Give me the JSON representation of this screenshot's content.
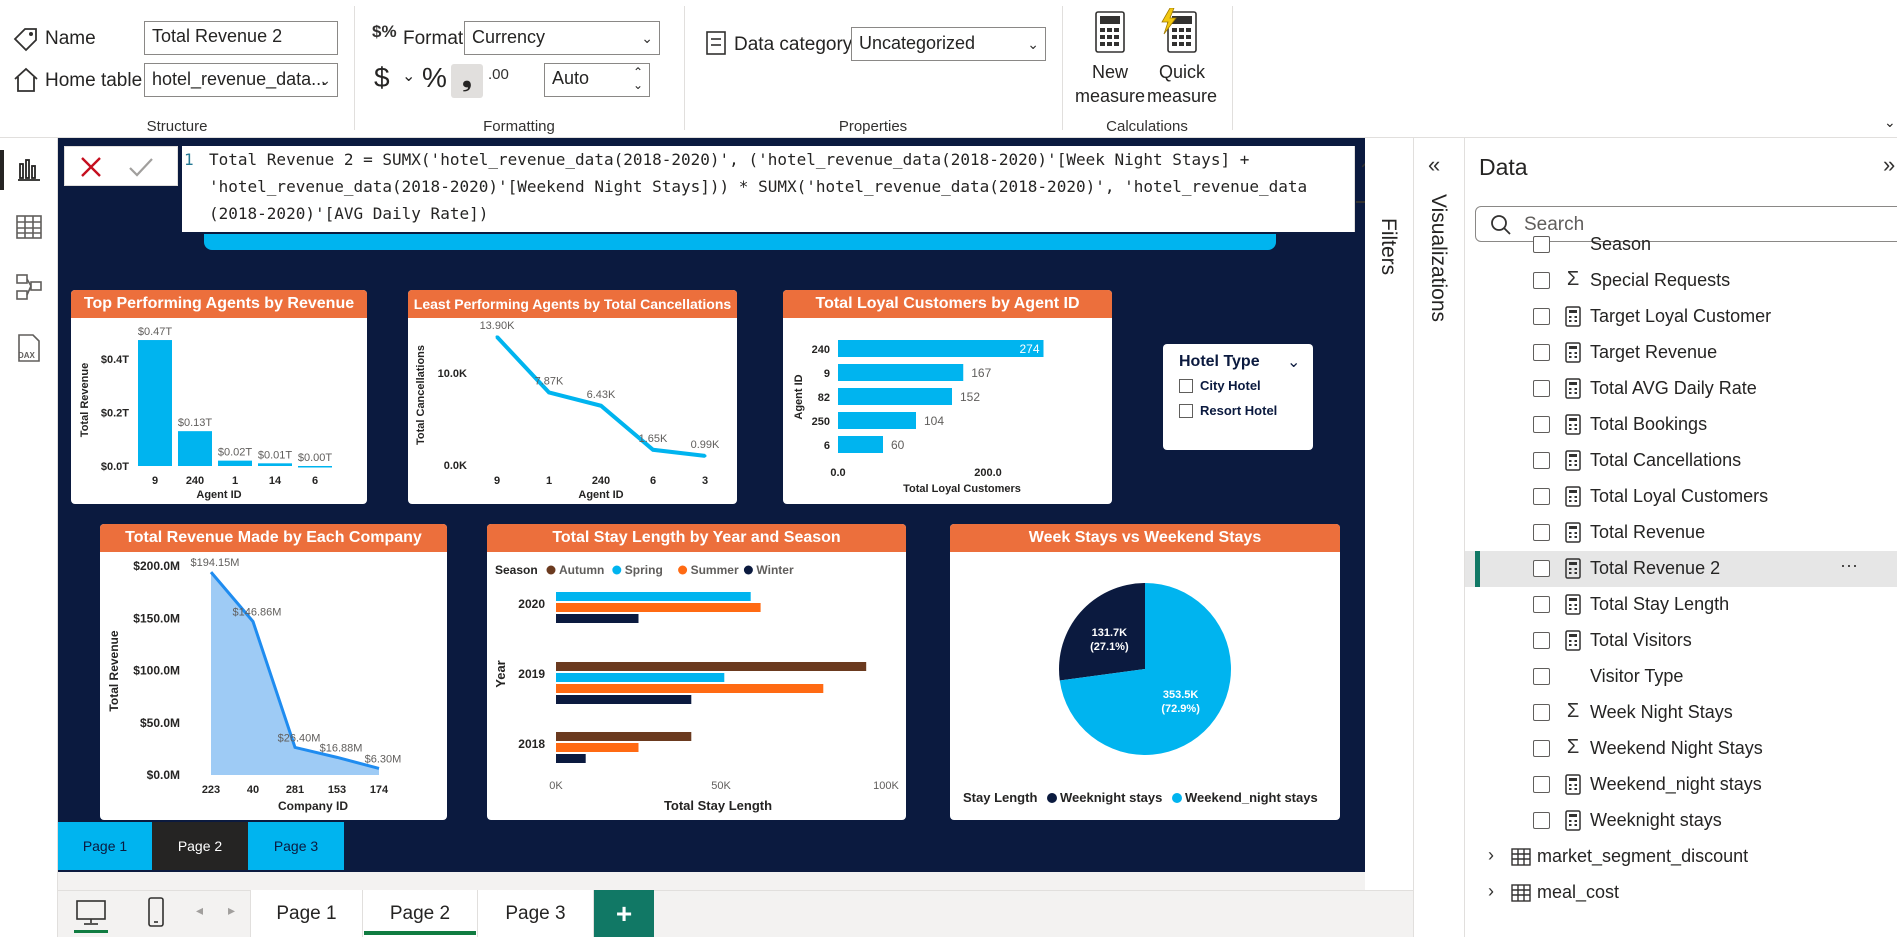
{
  "ribbon": {
    "structure": {
      "name_label": "Name",
      "name_value": "Total Revenue 2",
      "home_table_label": "Home table",
      "home_table_value": "hotel_revenue_data...",
      "group_label": "Structure"
    },
    "formatting": {
      "format_label": "Format",
      "format_value": "Currency",
      "currency_symbol": "$",
      "percent_symbol": "%",
      "decimals_value": "Auto",
      "decimals_glyph": ".00",
      "group_label": "Formatting"
    },
    "properties": {
      "data_category_label": "Data category",
      "data_category_value": "Uncategorized",
      "group_label": "Properties"
    },
    "calculations": {
      "new_measure_line1": "New",
      "new_measure_line2": "measure",
      "quick_measure_line1": "Quick",
      "quick_measure_line2": "measure",
      "group_label": "Calculations"
    }
  },
  "formula": {
    "line_number": "1",
    "line1": "Total Revenue 2 = SUMX('hotel_revenue_data(2018-2020)', ('hotel_revenue_data(2018-2020)'[Week Night Stays] +",
    "line2": "'hotel_revenue_data(2018-2020)'[Weekend Night Stays])) * SUMX('hotel_revenue_data(2018-2020)', 'hotel_revenue_data",
    "line3": "(2018-2020)'[AVG Daily Rate])"
  },
  "visuals": {
    "top_agents": {
      "title": "Top Performing Agents by Revenue",
      "ylabel": "Total Revenue",
      "xlabel": "Agent ID",
      "yticks": [
        "$0.4T",
        "$0.2T",
        "$0.0T"
      ],
      "categories": [
        "9",
        "240",
        "1",
        "14",
        "6"
      ],
      "labels": [
        "$0.47T",
        "$0.13T",
        "$0.02T",
        "$0.01T",
        "$0.00T"
      ]
    },
    "least_agents": {
      "title": "Least Performing Agents by Total Cancellations",
      "ylabel": "Total Cancellations",
      "xlabel": "Agent ID",
      "yticks": [
        "10.0K",
        "0.0K"
      ],
      "categories": [
        "9",
        "1",
        "240",
        "6",
        "3"
      ],
      "labels": [
        "13.90K",
        "7.87K",
        "6.43K",
        "1.65K",
        "0.99K"
      ]
    },
    "loyal": {
      "title": "Total Loyal Customers by Agent ID",
      "ylabel": "Agent ID",
      "xlabel": "Total Loyal Customers",
      "xticks": [
        "0.0",
        "200.0"
      ],
      "categories": [
        "240",
        "9",
        "82",
        "250",
        "6"
      ],
      "labels": [
        "274",
        "167",
        "152",
        "104",
        "60"
      ]
    },
    "hotel_slicer": {
      "title": "Hotel Type",
      "options": [
        "City Hotel",
        "Resort Hotel"
      ]
    },
    "company": {
      "title": "Total Revenue Made by Each Company",
      "ylabel": "Total Revenue",
      "xlabel": "Company ID",
      "yticks": [
        "$200.0M",
        "$150.0M",
        "$100.0M",
        "$50.0M",
        "$0.0M"
      ],
      "categories": [
        "223",
        "40",
        "281",
        "153",
        "174"
      ],
      "labels": [
        "$194.15M",
        "$146.86M",
        "$26.40M",
        "$16.88M",
        "$6.30M"
      ]
    },
    "stay_length": {
      "title": "Total Stay Length by Year and Season",
      "legend_title": "Season",
      "ylabel": "Year",
      "xlabel": "Total Stay Length",
      "xticks": [
        "0K",
        "50K",
        "100K"
      ],
      "years": [
        "2020",
        "2019",
        "2018"
      ]
    },
    "week_pie": {
      "title": "Week Stays vs Weekend Stays",
      "legend_title": "Stay Length",
      "slice1_value": "131.7K",
      "slice1_pct": "(27.1%)",
      "slice2_value": "353.5K",
      "slice2_pct": "(72.9%)"
    }
  },
  "chart_data": [
    {
      "type": "bar",
      "title": "Top Performing Agents by Revenue",
      "xlabel": "Agent ID",
      "ylabel": "Total Revenue",
      "categories": [
        "9",
        "240",
        "1",
        "14",
        "6"
      ],
      "values": [
        0.47,
        0.13,
        0.02,
        0.01,
        0.0
      ],
      "ylim": [
        0,
        0.5
      ]
    },
    {
      "type": "line",
      "title": "Least Performing Agents by Total Cancellations",
      "xlabel": "Agent ID",
      "ylabel": "Total Cancellations",
      "categories": [
        "9",
        "1",
        "240",
        "6",
        "3"
      ],
      "values": [
        13.9,
        7.87,
        6.43,
        1.65,
        0.99
      ],
      "ylim": [
        0,
        14
      ]
    },
    {
      "type": "bar",
      "title": "Total Loyal Customers by Agent ID",
      "xlabel": "Total Loyal Customers",
      "ylabel": "Agent ID",
      "categories": [
        "240",
        "9",
        "82",
        "250",
        "6"
      ],
      "values": [
        274,
        167,
        152,
        104,
        60
      ],
      "xlim": [
        0,
        300
      ]
    },
    {
      "type": "area",
      "title": "Total Revenue Made by Each Company",
      "xlabel": "Company ID",
      "ylabel": "Total Revenue",
      "categories": [
        "223",
        "40",
        "281",
        "153",
        "174"
      ],
      "values": [
        194.15,
        146.86,
        26.4,
        16.88,
        6.3
      ],
      "ylim": [
        0,
        200
      ]
    },
    {
      "type": "bar",
      "title": "Total Stay Length by Year and Season",
      "xlabel": "Total Stay Length",
      "ylabel": "Year",
      "categories": [
        "2020",
        "2019",
        "2018"
      ],
      "xlim": [
        0,
        100
      ],
      "series": [
        {
          "name": "Autumn",
          "color": "#6b3a1f",
          "values": [
            0,
            94,
            41
          ]
        },
        {
          "name": "Spring",
          "color": "#00b4ef",
          "values": [
            59,
            51,
            0
          ]
        },
        {
          "name": "Summer",
          "color": "#ff6a13",
          "values": [
            62,
            81,
            25
          ]
        },
        {
          "name": "Winter",
          "color": "#0b1a3f",
          "values": [
            25,
            41,
            9
          ]
        }
      ]
    },
    {
      "type": "pie",
      "title": "Week Stays vs Weekend Stays",
      "categories": [
        "Weeknight stays",
        "Weekend_night stays"
      ],
      "values": [
        131.7,
        353.5
      ],
      "colors": [
        "#0b1a3f",
        "#00b4ef"
      ]
    }
  ],
  "report_pages": {
    "page1": "Page 1",
    "page2": "Page 2",
    "page3": "Page 3"
  },
  "tabs": {
    "page1": "Page 1",
    "page2": "Page 2",
    "page3": "Page 3",
    "add": "+"
  },
  "right": {
    "filters_label": "Filters",
    "visualizations_label": "Visualizations",
    "data_title": "Data",
    "search_placeholder": "Search",
    "fields": [
      {
        "label": "Season",
        "icon": ""
      },
      {
        "label": "Special Requests",
        "icon": "Σ"
      },
      {
        "label": "Target Loyal Customer",
        "icon": "calc"
      },
      {
        "label": "Target Revenue",
        "icon": "calc"
      },
      {
        "label": "Total AVG Daily Rate",
        "icon": "calc"
      },
      {
        "label": "Total Bookings",
        "icon": "calc"
      },
      {
        "label": "Total Cancellations",
        "icon": "calc"
      },
      {
        "label": "Total Loyal Customers",
        "icon": "calc"
      },
      {
        "label": "Total Revenue",
        "icon": "calc"
      },
      {
        "label": "Total Revenue 2",
        "icon": "calc"
      },
      {
        "label": "Total Stay Length",
        "icon": "calc"
      },
      {
        "label": "Total Visitors",
        "icon": "calc"
      },
      {
        "label": "Visitor Type",
        "icon": ""
      },
      {
        "label": "Week Night Stays",
        "icon": "Σ"
      },
      {
        "label": "Weekend Night Stays",
        "icon": "Σ"
      },
      {
        "label": "Weekend_night stays",
        "icon": "calc"
      },
      {
        "label": "Weeknight stays",
        "icon": "calc"
      }
    ],
    "tables": [
      "market_segment_discount",
      "meal_cost"
    ],
    "more_glyph": "···"
  }
}
